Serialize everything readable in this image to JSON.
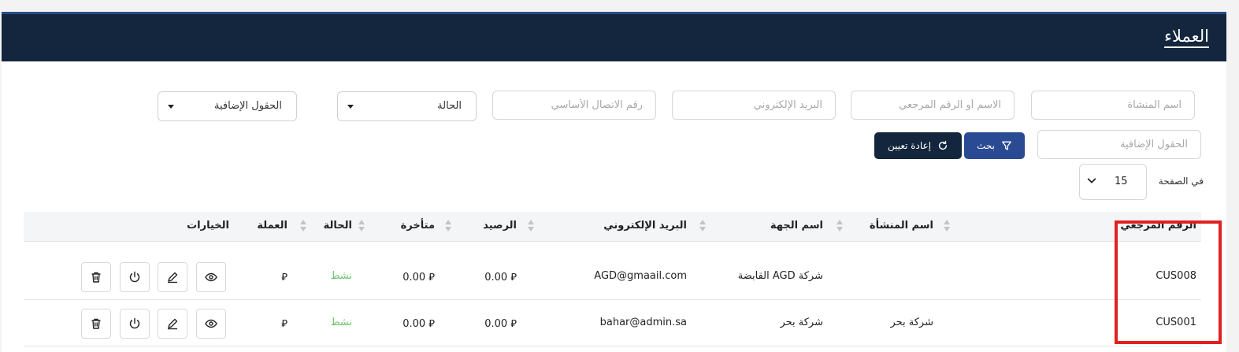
{
  "header": {
    "title": "العملاء"
  },
  "filters": {
    "facility_name_placeholder": "اسم المنشأة",
    "name_or_ref_placeholder": "الاسم أو الرقم المرجعي",
    "email_placeholder": "البريد الإلكتروني",
    "phone_placeholder": "رقم الاتصال الأساسي",
    "status_select": "الحالة",
    "extra_fields_select": "الحقول الإضافية",
    "extra_fields_placeholder": "الحقول الإضافية",
    "search_label": "بحث",
    "reset_label": "إعادة تعيين"
  },
  "pagination": {
    "per_page_label": "في الصفحة",
    "per_page_value": "15"
  },
  "table": {
    "headers": {
      "ref": "الرقم المرجعي",
      "facility": "اسم المنشأة",
      "entity": "اسم الجهة",
      "email": "البريد الإلكتروني",
      "balance": "الرصيد",
      "overdue": "متأخرة",
      "status": "الحالة",
      "currency": "العملة",
      "options": "الخيارات"
    },
    "rows": [
      {
        "ref": "CUS008",
        "facility": "",
        "entity": "شركة AGD القابضة",
        "email": "AGD@gmaail.com",
        "balance": "0.00 ⃁",
        "overdue": "0.00 ⃁",
        "status": "نشط",
        "currency": "⃁"
      },
      {
        "ref": "CUS001",
        "facility": "شركة بحر",
        "entity": "شركة بحر",
        "email": "bahar@admin.sa",
        "balance": "0.00 ⃁",
        "overdue": "0.00 ⃁",
        "status": "نشط",
        "currency": "⃁"
      }
    ]
  },
  "colors": {
    "header_bg": "#13263d",
    "search_btn": "#2a4a93",
    "status_active": "#6cc36c",
    "highlight": "#e02020"
  }
}
